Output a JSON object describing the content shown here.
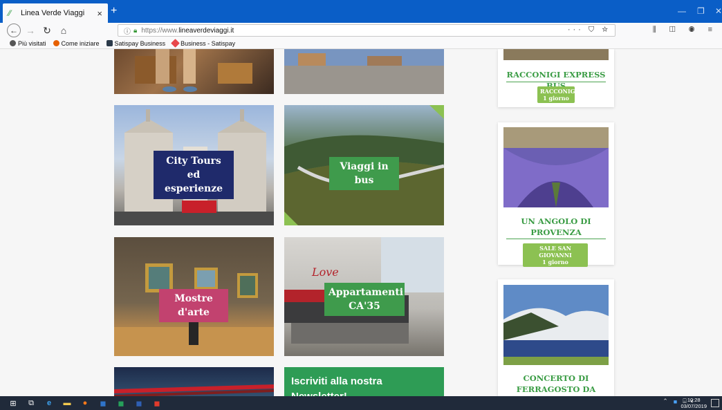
{
  "browser": {
    "tab_title": "Linea Verde Viaggi",
    "tab_close": "×",
    "new_tab": "+",
    "url_prefix": "https://www.",
    "url_domain": "lineaverdeviaggi.it",
    "url_actions": "··· ⛉ ☆",
    "right_buttons": "⫼ ◫ ◉ ≡"
  },
  "bookmarks": [
    {
      "label": "Più visitati",
      "color": "#555555"
    },
    {
      "label": "Come iniziare",
      "color": "#e66000"
    },
    {
      "label": "Satispay Business",
      "color": "#2b3a4a"
    },
    {
      "label": "Business - Satispay",
      "color": "#e8474a"
    }
  ],
  "tiles": {
    "city_tours": "City Tours ed esperienze",
    "bus": "Viaggi in bus",
    "mostre": "Mostre d'arte",
    "appartamenti": "Appartamenti CA'35",
    "newsletter": "Iscriviti alla nostra Newsletter!"
  },
  "sidebar": {
    "card1": {
      "title": "RACCONIGI EXPRESS BUS",
      "badge_place": "RACCONIGI",
      "badge_days": "1 giorno"
    },
    "card2": {
      "title": "UN ANGOLO DI PROVENZA",
      "badge_place": "SALE SAN GIOVANNI",
      "badge_days": "1 giorno"
    },
    "card3": {
      "title": "CONCERTO DI FERRAGOSTO DA TORINO"
    }
  },
  "taskbar": {
    "time": "10:28",
    "date": "03/07/2019"
  },
  "colors": {
    "brand_green": "#3a9c44",
    "badge_green": "#8cc152",
    "tile_blue_label": "#1f2a6b",
    "tile_green_label": "#3f9b4c",
    "tile_pink_label": "#c2426f"
  }
}
